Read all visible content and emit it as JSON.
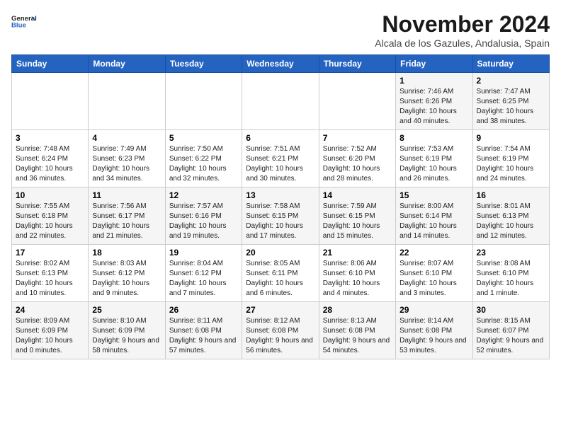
{
  "logo": {
    "line1": "General",
    "line2": "Blue"
  },
  "header": {
    "month_year": "November 2024",
    "location": "Alcala de los Gazules, Andalusia, Spain"
  },
  "weekdays": [
    "Sunday",
    "Monday",
    "Tuesday",
    "Wednesday",
    "Thursday",
    "Friday",
    "Saturday"
  ],
  "weeks": [
    [
      {
        "day": "",
        "info": ""
      },
      {
        "day": "",
        "info": ""
      },
      {
        "day": "",
        "info": ""
      },
      {
        "day": "",
        "info": ""
      },
      {
        "day": "",
        "info": ""
      },
      {
        "day": "1",
        "info": "Sunrise: 7:46 AM\nSunset: 6:26 PM\nDaylight: 10 hours and 40 minutes."
      },
      {
        "day": "2",
        "info": "Sunrise: 7:47 AM\nSunset: 6:25 PM\nDaylight: 10 hours and 38 minutes."
      }
    ],
    [
      {
        "day": "3",
        "info": "Sunrise: 7:48 AM\nSunset: 6:24 PM\nDaylight: 10 hours and 36 minutes."
      },
      {
        "day": "4",
        "info": "Sunrise: 7:49 AM\nSunset: 6:23 PM\nDaylight: 10 hours and 34 minutes."
      },
      {
        "day": "5",
        "info": "Sunrise: 7:50 AM\nSunset: 6:22 PM\nDaylight: 10 hours and 32 minutes."
      },
      {
        "day": "6",
        "info": "Sunrise: 7:51 AM\nSunset: 6:21 PM\nDaylight: 10 hours and 30 minutes."
      },
      {
        "day": "7",
        "info": "Sunrise: 7:52 AM\nSunset: 6:20 PM\nDaylight: 10 hours and 28 minutes."
      },
      {
        "day": "8",
        "info": "Sunrise: 7:53 AM\nSunset: 6:19 PM\nDaylight: 10 hours and 26 minutes."
      },
      {
        "day": "9",
        "info": "Sunrise: 7:54 AM\nSunset: 6:19 PM\nDaylight: 10 hours and 24 minutes."
      }
    ],
    [
      {
        "day": "10",
        "info": "Sunrise: 7:55 AM\nSunset: 6:18 PM\nDaylight: 10 hours and 22 minutes."
      },
      {
        "day": "11",
        "info": "Sunrise: 7:56 AM\nSunset: 6:17 PM\nDaylight: 10 hours and 21 minutes."
      },
      {
        "day": "12",
        "info": "Sunrise: 7:57 AM\nSunset: 6:16 PM\nDaylight: 10 hours and 19 minutes."
      },
      {
        "day": "13",
        "info": "Sunrise: 7:58 AM\nSunset: 6:15 PM\nDaylight: 10 hours and 17 minutes."
      },
      {
        "day": "14",
        "info": "Sunrise: 7:59 AM\nSunset: 6:15 PM\nDaylight: 10 hours and 15 minutes."
      },
      {
        "day": "15",
        "info": "Sunrise: 8:00 AM\nSunset: 6:14 PM\nDaylight: 10 hours and 14 minutes."
      },
      {
        "day": "16",
        "info": "Sunrise: 8:01 AM\nSunset: 6:13 PM\nDaylight: 10 hours and 12 minutes."
      }
    ],
    [
      {
        "day": "17",
        "info": "Sunrise: 8:02 AM\nSunset: 6:13 PM\nDaylight: 10 hours and 10 minutes."
      },
      {
        "day": "18",
        "info": "Sunrise: 8:03 AM\nSunset: 6:12 PM\nDaylight: 10 hours and 9 minutes."
      },
      {
        "day": "19",
        "info": "Sunrise: 8:04 AM\nSunset: 6:12 PM\nDaylight: 10 hours and 7 minutes."
      },
      {
        "day": "20",
        "info": "Sunrise: 8:05 AM\nSunset: 6:11 PM\nDaylight: 10 hours and 6 minutes."
      },
      {
        "day": "21",
        "info": "Sunrise: 8:06 AM\nSunset: 6:10 PM\nDaylight: 10 hours and 4 minutes."
      },
      {
        "day": "22",
        "info": "Sunrise: 8:07 AM\nSunset: 6:10 PM\nDaylight: 10 hours and 3 minutes."
      },
      {
        "day": "23",
        "info": "Sunrise: 8:08 AM\nSunset: 6:10 PM\nDaylight: 10 hours and 1 minute."
      }
    ],
    [
      {
        "day": "24",
        "info": "Sunrise: 8:09 AM\nSunset: 6:09 PM\nDaylight: 10 hours and 0 minutes."
      },
      {
        "day": "25",
        "info": "Sunrise: 8:10 AM\nSunset: 6:09 PM\nDaylight: 9 hours and 58 minutes."
      },
      {
        "day": "26",
        "info": "Sunrise: 8:11 AM\nSunset: 6:08 PM\nDaylight: 9 hours and 57 minutes."
      },
      {
        "day": "27",
        "info": "Sunrise: 8:12 AM\nSunset: 6:08 PM\nDaylight: 9 hours and 56 minutes."
      },
      {
        "day": "28",
        "info": "Sunrise: 8:13 AM\nSunset: 6:08 PM\nDaylight: 9 hours and 54 minutes."
      },
      {
        "day": "29",
        "info": "Sunrise: 8:14 AM\nSunset: 6:08 PM\nDaylight: 9 hours and 53 minutes."
      },
      {
        "day": "30",
        "info": "Sunrise: 8:15 AM\nSunset: 6:07 PM\nDaylight: 9 hours and 52 minutes."
      }
    ]
  ]
}
